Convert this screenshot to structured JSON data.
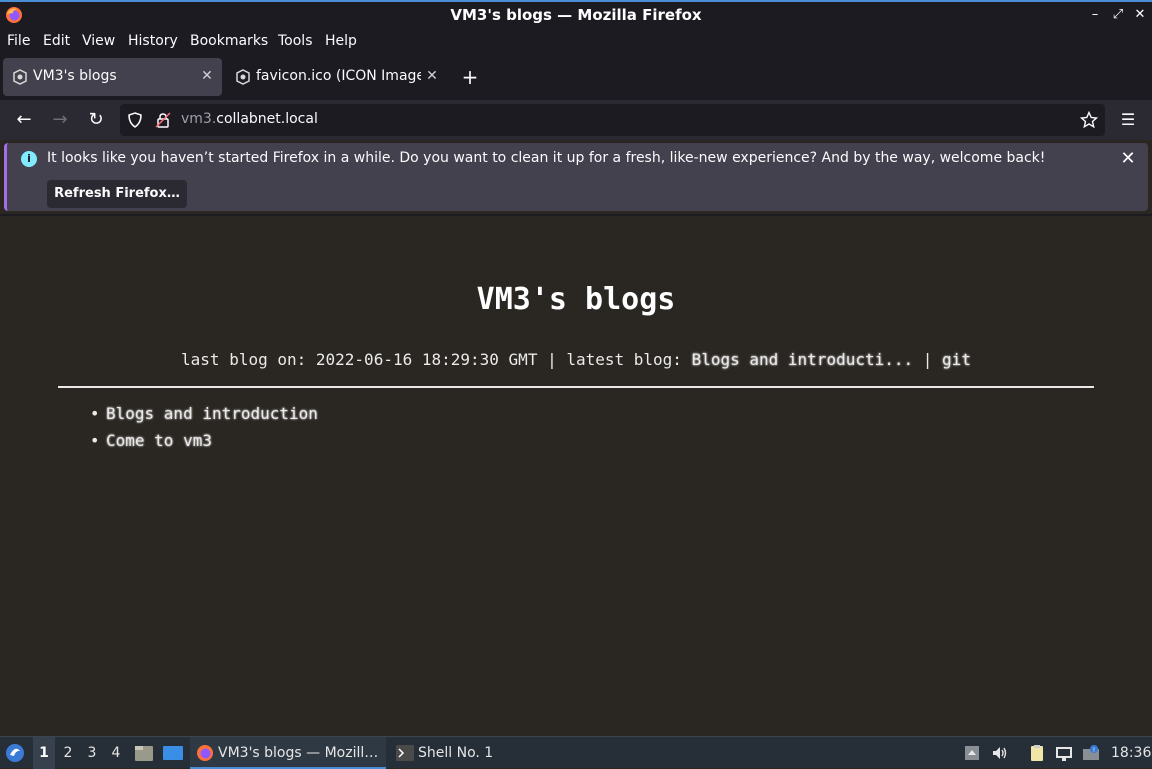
{
  "window": {
    "title": "VM3's blogs — Mozilla Firefox"
  },
  "menu": [
    "File",
    "Edit",
    "View",
    "History",
    "Bookmarks",
    "Tools",
    "Help"
  ],
  "tabs": [
    {
      "label": "VM3's blogs",
      "active": true
    },
    {
      "label": "favicon.ico (ICON Image,",
      "active": false
    }
  ],
  "urlbar": {
    "host_prefix": "vm3.",
    "host_domain": "collabnet.local"
  },
  "notification": {
    "message": "It looks like you haven’t started Firefox in a while. Do you want to clean it up for a fresh, like-new experience? And by the way, welcome back!",
    "button": "Refresh Firefox…"
  },
  "page": {
    "heading": "VM3's blogs",
    "meta_prefix": "last blog on: 2022-06-16 18:29:30 GMT | latest blog: ",
    "latest_link": "Blogs and introducti...",
    "separator": " | ",
    "git_link": "git",
    "posts": [
      "Blogs and introduction",
      "Come to vm3"
    ]
  },
  "taskbar": {
    "workspaces": [
      "1",
      "2",
      "3",
      "4"
    ],
    "tasks": [
      {
        "label": "VM3's blogs — Mozill…",
        "active": true
      },
      {
        "label": "Shell No. 1",
        "active": false
      }
    ],
    "clock": "18:36"
  }
}
